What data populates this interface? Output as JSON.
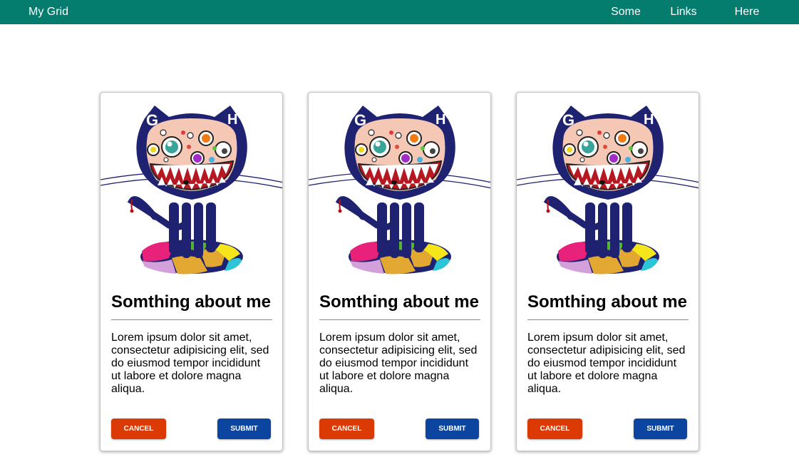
{
  "navbar": {
    "brand": "My Grid",
    "links": [
      "Some",
      "Links",
      "Here"
    ],
    "background": "#047d6f"
  },
  "cards": [
    {
      "image_icon": "octocat-monster-illustration",
      "title": "Somthing about me",
      "text": "Lorem ipsum dolor sit amet, consectetur adipisicing elit, sed do eiusmod tempor incididunt ut labore et dolore magna aliqua.",
      "cancel_label": "Cancel",
      "submit_label": "Submit"
    },
    {
      "image_icon": "octocat-monster-illustration",
      "title": "Somthing about me",
      "text": "Lorem ipsum dolor sit amet, consectetur adipisicing elit, sed do eiusmod tempor incididunt ut labore et dolore magna aliqua.",
      "cancel_label": "Cancel",
      "submit_label": "Submit"
    },
    {
      "image_icon": "octocat-monster-illustration",
      "title": "Somthing about me",
      "text": "Lorem ipsum dolor sit amet, consectetur adipisicing elit, sed do eiusmod tempor incididunt ut labore et dolore magna aliqua.",
      "cancel_label": "Cancel",
      "submit_label": "Submit"
    }
  ],
  "colors": {
    "cancel": "#db3a04",
    "submit": "#0c45a0"
  }
}
